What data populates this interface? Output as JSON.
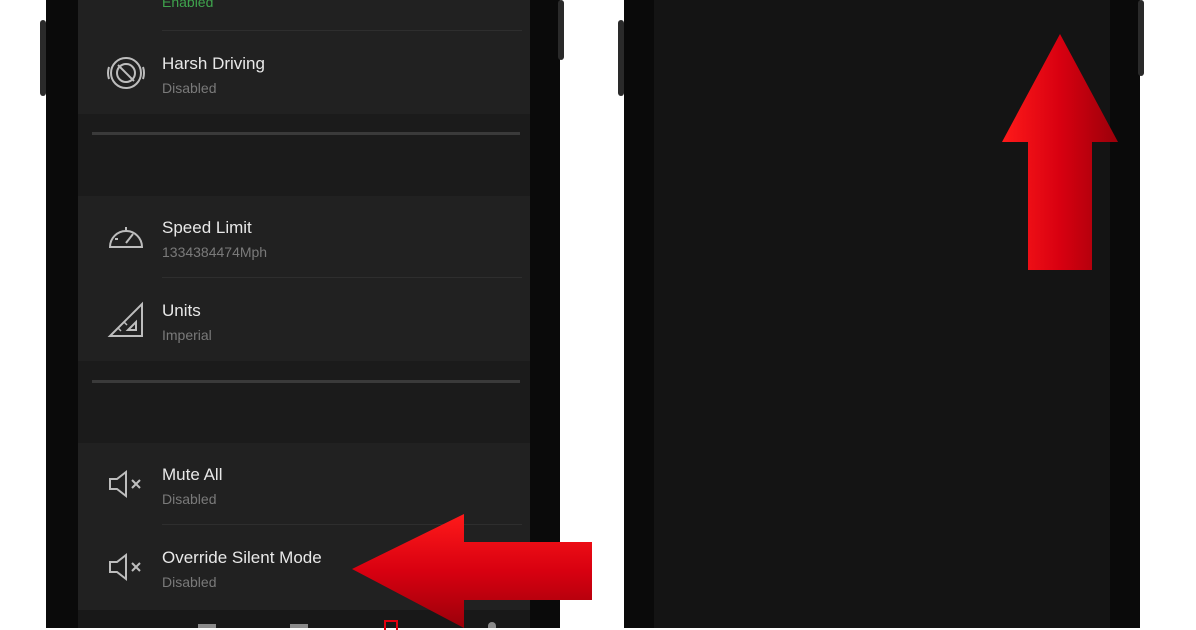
{
  "left_phone": {
    "top_item": {
      "subtitle": "Enabled"
    },
    "items": [
      {
        "title": "Harsh Driving",
        "subtitle": "Disabled",
        "icon": "harsh-driving-icon"
      },
      {
        "title": "Speed Limit",
        "subtitle": "1334384474Mph",
        "icon": "speedometer-icon"
      },
      {
        "title": "Units",
        "subtitle": "Imperial",
        "icon": "ruler-triangle-icon"
      },
      {
        "title": "Mute All",
        "subtitle": "Disabled",
        "icon": "speaker-mute-icon"
      },
      {
        "title": "Override Silent Mode",
        "subtitle": "Disabled",
        "icon": "speaker-mute-icon"
      }
    ]
  },
  "colors": {
    "screen_bg": "#212121",
    "text_primary": "#e8e8e8",
    "text_secondary": "#7a7a7a",
    "enabled_green": "#3fa34d",
    "arrow_red": "#e3000f"
  },
  "annotations": {
    "left_arrow": "pointing-left-red-arrow",
    "right_arrow": "pointing-up-red-arrow"
  }
}
